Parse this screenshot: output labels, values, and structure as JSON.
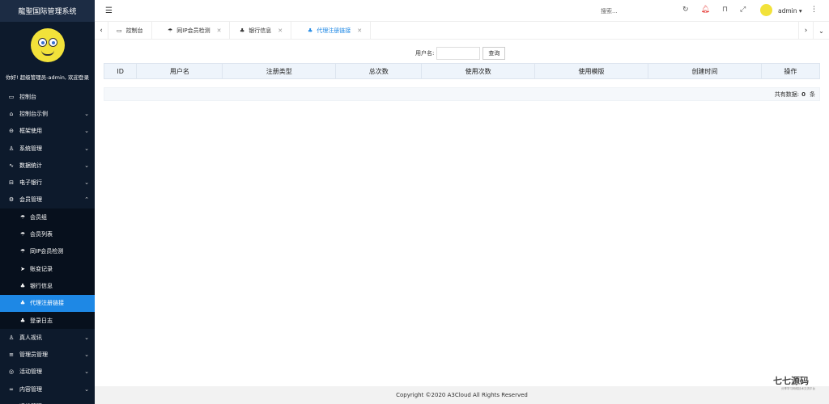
{
  "app": {
    "title": "龍聖国际管理系统",
    "welcome": "你好! 超级管理员-admin, 欢迎登录"
  },
  "sidebar": {
    "items": [
      {
        "label": "控制台",
        "icon": "monitor-icon",
        "glyph": "▭",
        "expandable": false
      },
      {
        "label": "控制台示例",
        "icon": "home-icon",
        "glyph": "⌂",
        "expandable": true
      },
      {
        "label": "框架使用",
        "icon": "shield-icon",
        "glyph": "⊖",
        "expandable": true
      },
      {
        "label": "系统管理",
        "icon": "user-icon",
        "glyph": "♙",
        "expandable": true
      },
      {
        "label": "数据统计",
        "icon": "pulse-icon",
        "glyph": "∿",
        "expandable": true
      },
      {
        "label": "电子银行",
        "icon": "bank-icon",
        "glyph": "⊟",
        "expandable": true
      },
      {
        "label": "会员管理",
        "icon": "gear-icon",
        "glyph": "⚙",
        "expandable": true,
        "expanded": true
      }
    ],
    "subitems": [
      {
        "label": "会员组",
        "icon": "umbrella-icon",
        "glyph": "☂"
      },
      {
        "label": "会员列表",
        "icon": "umbrella-icon",
        "glyph": "☂"
      },
      {
        "label": "同IP会员检测",
        "icon": "umbrella-icon",
        "glyph": "☂"
      },
      {
        "label": "账变记录",
        "icon": "send-icon",
        "glyph": "➤"
      },
      {
        "label": "银行信息",
        "icon": "network-icon",
        "glyph": "♣"
      },
      {
        "label": "代理注册链接",
        "icon": "network-icon",
        "glyph": "♣",
        "active": true
      },
      {
        "label": "登录日志",
        "icon": "network-icon",
        "glyph": "♣"
      }
    ],
    "items_after": [
      {
        "label": "真人视讯",
        "icon": "users-icon",
        "glyph": "♙",
        "expandable": true
      },
      {
        "label": "管理员管理",
        "icon": "list-icon",
        "glyph": "≡",
        "expandable": true
      },
      {
        "label": "活动管理",
        "icon": "target-icon",
        "glyph": "◎",
        "expandable": true
      },
      {
        "label": "内容管理",
        "icon": "chain-icon",
        "glyph": "∞",
        "expandable": true
      },
      {
        "label": "运维管理",
        "icon": "server-icon",
        "glyph": "▭",
        "expandable": true
      }
    ]
  },
  "topbar": {
    "search_placeholder": "搜索...",
    "user_name": "admin"
  },
  "tabs": [
    {
      "label": "控制台",
      "icon": "monitor-icon",
      "closable": false
    },
    {
      "label": "同IP会员检测",
      "icon": "umbrella-icon",
      "closable": true
    },
    {
      "label": "银行信息",
      "icon": "network-icon",
      "closable": true
    },
    {
      "label": "代理注册链接",
      "icon": "network-icon",
      "closable": true,
      "active": true
    }
  ],
  "filter": {
    "label": "用户名:",
    "value": "",
    "button": "查询"
  },
  "table": {
    "columns": [
      "ID",
      "用户名",
      "注册类型",
      "总次数",
      "使用次数",
      "使用模版",
      "创建时间",
      "操作"
    ],
    "rows": []
  },
  "pagination": {
    "total_label": "共有数据:",
    "total": "0",
    "unit": "条"
  },
  "footer": {
    "copyright": "Copyright ©2020 A3Cloud All Rights Reserved"
  },
  "watermark": {
    "main": "七七源码",
    "sub": "分享学习网络技术交流平台"
  },
  "colors": {
    "sidebar_bg": "#0d1a2c",
    "accent": "#1e88e5",
    "header_bg": "#eef4fb"
  }
}
